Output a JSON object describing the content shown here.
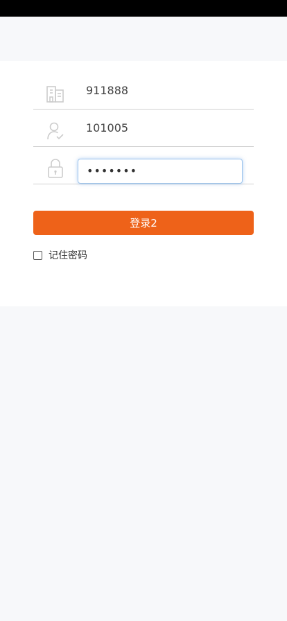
{
  "login": {
    "company_code": "911888",
    "user_id": "101005",
    "password_masked": "•••••••",
    "login_button_label": "登录2",
    "remember_label": "记住密码"
  },
  "icons": {
    "company": "building-icon",
    "user": "user-check-icon",
    "password": "lock-icon"
  },
  "colors": {
    "accent": "#ee6219",
    "focus": "#9fc6ee",
    "divider": "#cfcfcf",
    "icon": "#cccccc"
  }
}
